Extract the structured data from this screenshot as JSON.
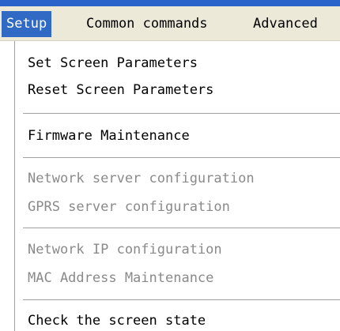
{
  "menubar": {
    "items": [
      {
        "label": "Setup",
        "active": true
      },
      {
        "label": "Common commands",
        "active": false
      },
      {
        "label": "Advanced",
        "active": false
      }
    ]
  },
  "dropdown": {
    "items": [
      {
        "label": "Set Screen Parameters",
        "enabled": true
      },
      {
        "label": "Reset Screen Parameters",
        "enabled": true
      },
      {
        "label": "Firmware Maintenance",
        "enabled": true
      },
      {
        "label": "Network server configuration",
        "enabled": false
      },
      {
        "label": "GPRS server configuration",
        "enabled": false
      },
      {
        "label": "Network IP configuration",
        "enabled": false
      },
      {
        "label": "MAC Address Maintenance",
        "enabled": false
      },
      {
        "label": "Check the screen state",
        "enabled": true
      }
    ]
  },
  "colors": {
    "highlight": "#316ac5",
    "menubar_bg": "#ece9d8",
    "disabled_text": "#8a8a8a",
    "title_strip": "#2a63c9"
  }
}
